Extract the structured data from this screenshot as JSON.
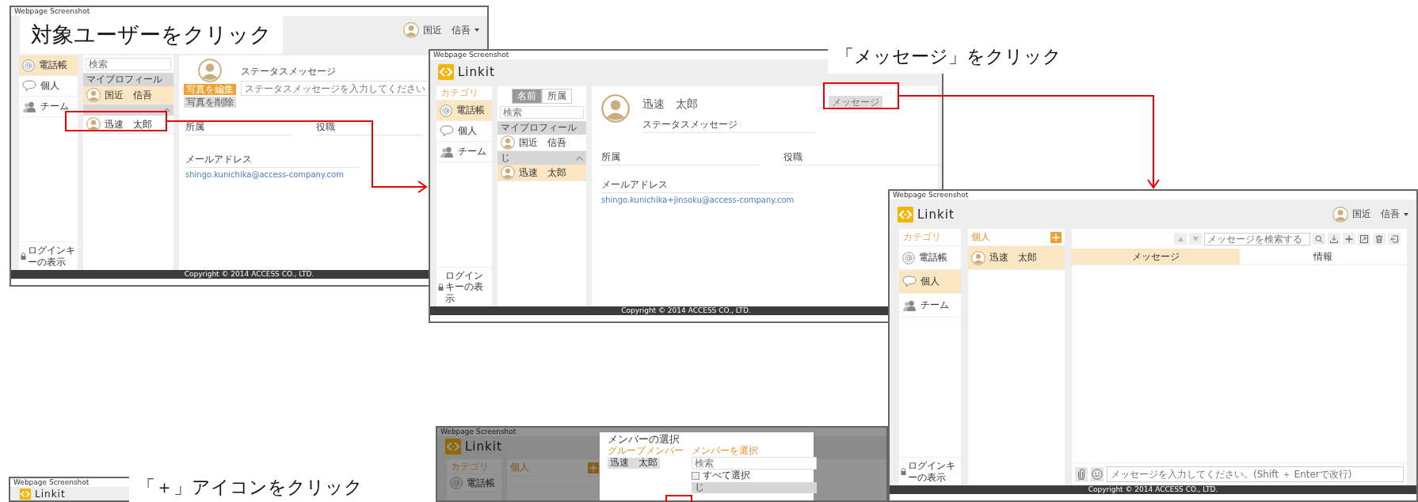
{
  "captions": [
    {
      "text": "対象ユーザーをクリック"
    },
    {
      "text": "「メッセージ」をクリック"
    },
    {
      "text": "「＋」アイコンをクリック"
    }
  ],
  "shots": [
    {
      "kind": "profile",
      "label": "Webpage Screenshot",
      "user": "国近　信吾",
      "categories": [
        {
          "label": "電話帳",
          "selected": true
        },
        {
          "label": "個人",
          "selected": false
        },
        {
          "label": "チーム",
          "selected": false
        }
      ],
      "login_key": "ログインキーの表示",
      "search_placeholder": "検索",
      "sections": [
        {
          "title": "マイプロフィール",
          "rows": [
            {
              "name": "国近　信吾",
              "selected": true
            }
          ]
        },
        {
          "expanded": true,
          "rows": [
            {
              "name": "迅速　太郎",
              "selected": false
            }
          ]
        }
      ],
      "profile": {
        "edit_photo": "写真を編集",
        "delete_photo": "写真を削除",
        "status_label": "ステータスメッセージ",
        "status_placeholder": "ステータスメッセージを入力してください",
        "fields": [
          "所属",
          "役職"
        ],
        "email_label": "メールアドレス",
        "email": "shingo.kunichika@access-company.com"
      },
      "copyright": "Copyright © 2014 ACCESS CO., LTD."
    },
    {
      "kind": "contact",
      "label": "Webpage Screenshot",
      "logo": "Linkit",
      "category_heading": "カテゴリ",
      "categories": [
        {
          "label": "電話帳",
          "selected": true
        },
        {
          "label": "個人",
          "selected": false
        },
        {
          "label": "チーム",
          "selected": false
        }
      ],
      "login_key": "ログインキーの表示",
      "list_tabs": [
        {
          "label": "名前",
          "selected": true
        },
        {
          "label": "所属",
          "selected": false
        }
      ],
      "search_placeholder": "検索",
      "sections": [
        {
          "title": "マイプロフィール",
          "rows": [
            {
              "name": "国近　信吾",
              "selected": false
            }
          ]
        },
        {
          "title": "じ",
          "expanded": true,
          "rows": [
            {
              "name": "迅速　太郎",
              "selected": true
            }
          ]
        }
      ],
      "contact": {
        "name": "迅速　太郎",
        "status_label": "ステータスメッセージ",
        "message_button": "メッセージ",
        "fields": [
          "所属",
          "役職"
        ],
        "email_label": "メールアドレス",
        "email": "shingo.kunichika+jinsoku@access-company.com"
      },
      "copyright": "Copyright © 2014 ACCESS CO., LTD."
    },
    {
      "kind": "header",
      "label": "Webpage Screenshot",
      "logo": "Linkit"
    },
    {
      "kind": "dialog",
      "label": "Webpage Screenshot",
      "logo": "Linkit",
      "category_heading": "カテゴリ",
      "categories": [
        {
          "label": "電話帳",
          "selected": false
        }
      ],
      "list_heading": "個人",
      "dialog": {
        "title": "メンバーの選択",
        "group_label": "グループメンバー",
        "group_members": [
          "迅速　太郎"
        ],
        "select_label": "メンバーを選択",
        "search_placeholder": "検索",
        "select_all": {
          "label": "すべて選択",
          "checked": false
        },
        "section": "じ"
      }
    },
    {
      "kind": "chat",
      "label": "Webpage Screenshot",
      "logo": "Linkit",
      "user": "国近　信吾",
      "category_heading": "カテゴリ",
      "categories": [
        {
          "label": "電話帳",
          "selected": false
        },
        {
          "label": "個人",
          "selected": true
        },
        {
          "label": "チーム",
          "selected": false
        }
      ],
      "login_key": "ログインキーの表示",
      "list_heading": "個人",
      "rows": [
        {
          "name": "迅速　太郎",
          "selected": true
        }
      ],
      "chat": {
        "search_placeholder": "メッセージを検索する",
        "tabs": [
          {
            "label": "メッセージ",
            "selected": true
          },
          {
            "label": "情報",
            "selected": false
          }
        ],
        "input_placeholder": "メッセージを入力してください。(Shift ＋ Enterで改行)"
      },
      "copyright": "Copyright © 2014 ACCESS CO., LTD."
    }
  ]
}
